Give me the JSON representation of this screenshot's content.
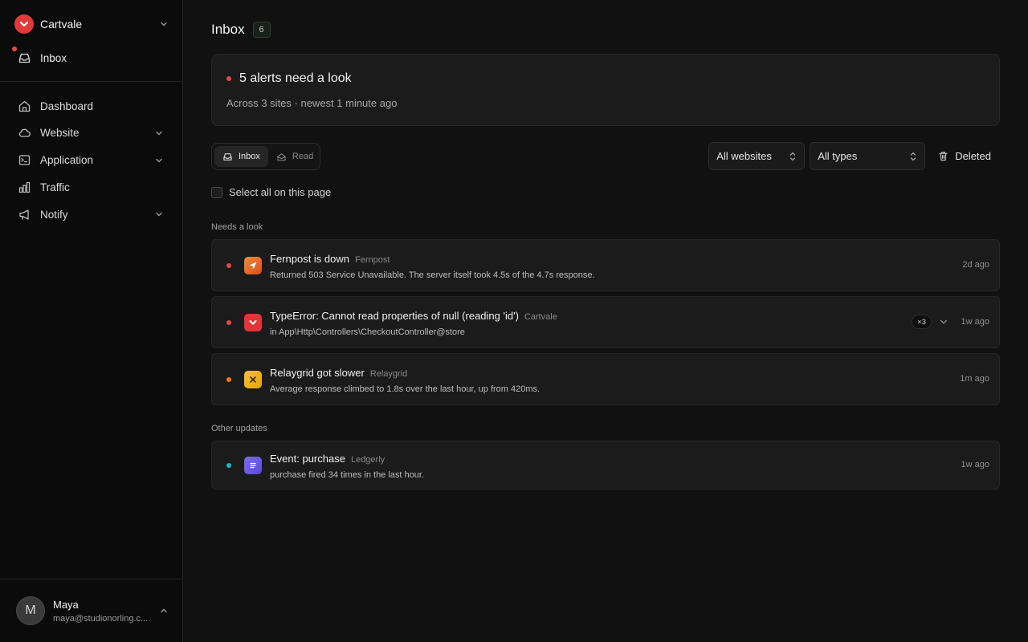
{
  "sidebar": {
    "brand": {
      "name": "Cartvale",
      "logo_icon": "cartvale-logo",
      "accent": "#e23a3a"
    },
    "inbox": {
      "label": "Inbox",
      "icon": "inbox-icon",
      "unread_dot_color": "#ef4444"
    },
    "items": [
      {
        "label": "Dashboard",
        "icon": "home-icon",
        "expandable": false
      },
      {
        "label": "Website",
        "icon": "cloud-icon",
        "expandable": true
      },
      {
        "label": "Application",
        "icon": "terminal-icon",
        "expandable": true
      },
      {
        "label": "Traffic",
        "icon": "bar-chart-icon",
        "expandable": false
      },
      {
        "label": "Notify",
        "icon": "megaphone-icon",
        "expandable": true
      }
    ],
    "user": {
      "initial": "M",
      "name": "Maya",
      "email": "maya@studionorling.c..."
    }
  },
  "header": {
    "title": "Inbox",
    "count": "6"
  },
  "summary": {
    "title": "5 alerts need a look",
    "subtitle": "Across 3 sites · newest 1 minute ago"
  },
  "toolbar": {
    "toggle": [
      {
        "label": "Inbox",
        "icon": "inbox-icon",
        "active": true
      },
      {
        "label": "Read",
        "icon": "inbox-open-icon",
        "active": false
      }
    ],
    "site_filter": "All websites",
    "type_filter": "All types",
    "deleted_label": "Deleted",
    "select_all_label": "Select all on this page"
  },
  "sections": {
    "needs_look": "Needs a look",
    "other_updates": "Other updates"
  },
  "alerts": [
    {
      "title": "Fernpost is down",
      "source": "Fernpost",
      "description": "Returned 503 Service Unavailable. The server itself took 4.5s of the 4.7s response.",
      "time": "2d ago",
      "dot_color": "#ef4444",
      "icon": "fernpost-icon"
    },
    {
      "title": "TypeError: Cannot read properties of null (reading 'id')",
      "source": "Cartvale",
      "description": "in App\\Http\\Controllers\\CheckoutController@store",
      "time": "1w ago",
      "count": "×3",
      "dot_color": "#ef4444",
      "icon": "cartvale-icon"
    },
    {
      "title": "Relaygrid got slower",
      "source": "Relaygrid",
      "description": "Average response climbed to 1.8s over the last hour, up from 420ms.",
      "time": "1m ago",
      "dot_color": "#f97316",
      "icon": "relaygrid-icon"
    }
  ],
  "updates": [
    {
      "title": "Event: purchase",
      "source": "Ledgerly",
      "description": "purchase fired 34 times in the last hour.",
      "time": "1w ago",
      "dot_color": "#14b8c8",
      "icon": "ledgerly-icon"
    }
  ]
}
